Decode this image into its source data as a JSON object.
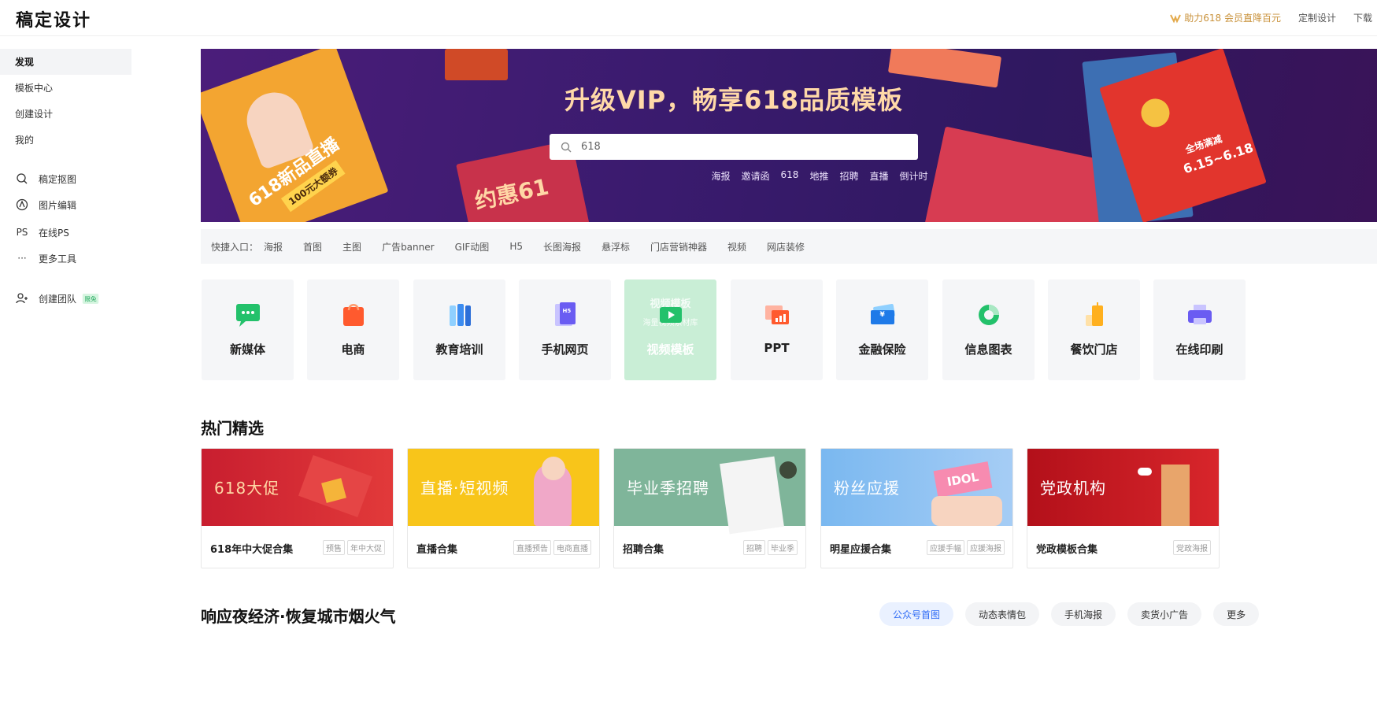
{
  "header": {
    "brand": "稿定设计",
    "promo": "助力618 会员直降百元",
    "links": [
      "定制设计",
      "下载"
    ],
    "colors": {
      "promo": "#c9923b"
    }
  },
  "sidebar": {
    "nav": [
      {
        "label": "发现",
        "active": true
      },
      {
        "label": "模板中心"
      },
      {
        "label": "创建设计"
      },
      {
        "label": "我的"
      }
    ],
    "tools": [
      {
        "label": "稿定抠图",
        "icon": "cutout-icon"
      },
      {
        "label": "图片编辑",
        "icon": "image-edit-icon"
      },
      {
        "label": "在线PS",
        "icon": "ps-icon",
        "glyph": "PS"
      },
      {
        "label": "更多工具",
        "icon": "more-icon",
        "glyph": "···"
      }
    ],
    "team": {
      "label": "创建团队",
      "badge": "限免"
    }
  },
  "hero": {
    "title": "升级VIP，畅享618品质模板",
    "search_value": "618",
    "tags": [
      "海报",
      "邀请函",
      "618",
      "地推",
      "招聘",
      "直播",
      "倒计时"
    ],
    "poster_texts": [
      "618新品直播",
      "100元大额券",
      "约惠61",
      "6.15~6.18",
      "全场满减"
    ]
  },
  "quick": {
    "label": "快捷入口：",
    "items": [
      "海报",
      "首图",
      "主图",
      "广告banner",
      "GIF动图",
      "H5",
      "长图海报",
      "悬浮标",
      "门店营销神器",
      "视频",
      "网店装修"
    ]
  },
  "categories": [
    {
      "label": "新媒体",
      "icon": "chat-bubble-icon"
    },
    {
      "label": "电商",
      "icon": "shopping-bag-icon"
    },
    {
      "label": "教育培训",
      "icon": "books-icon"
    },
    {
      "label": "手机网页",
      "icon": "h5-page-icon",
      "glyph": "H5"
    },
    {
      "label": "视频模板",
      "icon": "video-play-icon",
      "highlight": true,
      "ghost": "视频模板",
      "ghost2": "海量视频素材库"
    },
    {
      "label": "PPT",
      "icon": "ppt-chart-icon"
    },
    {
      "label": "金融保险",
      "icon": "card-yuan-icon",
      "glyph": "¥"
    },
    {
      "label": "信息图表",
      "icon": "donut-chart-icon"
    },
    {
      "label": "餐饮门店",
      "icon": "drink-cup-icon"
    },
    {
      "label": "在线印刷",
      "icon": "printer-icon"
    }
  ],
  "hot": {
    "title": "热门精选",
    "cards": [
      {
        "img_text": "618大促",
        "name": "618年中大促合集",
        "tags": [
          "预售",
          "年中大促"
        ],
        "bg": "#c81e2f"
      },
      {
        "img_text": "直播·短视频",
        "name": "直播合集",
        "tags": [
          "直播预告",
          "电商直播"
        ],
        "bg": "#f8c51a"
      },
      {
        "img_text": "毕业季招聘",
        "name": "招聘合集",
        "tags": [
          "招聘",
          "毕业季"
        ],
        "bg": "#7fb59a"
      },
      {
        "img_text": "粉丝应援",
        "name": "明星应援合集",
        "tags": [
          "应援手幅",
          "应援海报"
        ],
        "bg": "#7ab8f0",
        "sign": "IDOL"
      },
      {
        "img_text": "党政机构",
        "name": "党政模板合集",
        "tags": [
          "党政海报"
        ],
        "bg": "#c2141e"
      }
    ]
  },
  "night": {
    "title": "响应夜经济·恢复城市烟火气",
    "pills": [
      "公众号首图",
      "动态表情包",
      "手机海报",
      "卖货小广告",
      "更多"
    ]
  }
}
